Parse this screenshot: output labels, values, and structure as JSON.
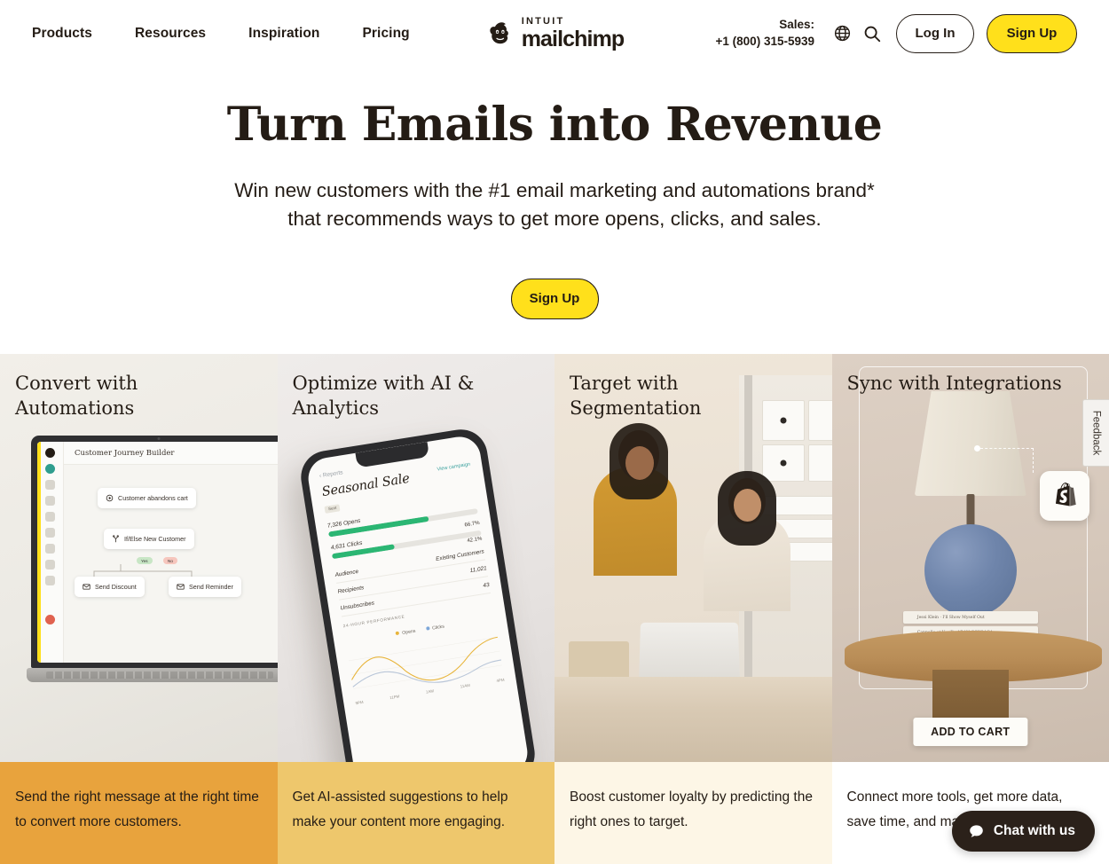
{
  "header": {
    "nav_items": [
      {
        "label": "Products"
      },
      {
        "label": "Resources"
      },
      {
        "label": "Inspiration"
      },
      {
        "label": "Pricing"
      }
    ],
    "logo": {
      "brand_prefix": "INTUIT",
      "brand_name": "mailchimp",
      "icon": "mailchimp-chimp-icon"
    },
    "sales_label": "Sales:",
    "sales_phone": "+1 (800) 315-5939",
    "globe_icon": "globe-icon",
    "search_icon": "search-icon",
    "login_label": "Log In",
    "signup_label": "Sign Up"
  },
  "hero": {
    "title": "Turn Emails into Revenue",
    "subtitle": "Win new customers with the #1 email marketing and automations brand* that recommends ways to get more opens, clicks, and sales.",
    "cta_label": "Sign Up"
  },
  "cards": [
    {
      "title": "Convert with Automations",
      "description": "Send the right message at the right time to convert more customers.",
      "bg_color": "#e8a33d",
      "scene": {
        "app_title": "Customer Journey Builder",
        "nodes": [
          {
            "label": "Customer abandons cart",
            "icon": "play-circle-icon"
          },
          {
            "label": "If/Else New Customer",
            "icon": "branch-icon"
          },
          {
            "label": "Send Discount",
            "icon": "envelope-icon"
          },
          {
            "label": "Send Reminder",
            "icon": "envelope-icon"
          }
        ],
        "branch_yes": "Yes",
        "branch_no": "No"
      }
    },
    {
      "title": "Optimize with AI & Analytics",
      "description": "Get AI-assisted suggestions to help make your content more engaging.",
      "bg_color": "#eec76c",
      "scene": {
        "back_label": "Reports",
        "report_title": "Seasonal Sale",
        "report_tag": "Sent",
        "view_campaign": "View campaign",
        "metrics": [
          {
            "label": "7,326 Opens",
            "pct_label": "66.7%",
            "pct": 66.7
          },
          {
            "label": "4,631 Clicks",
            "pct_label": "42.1%",
            "pct": 42.1
          }
        ],
        "rows": [
          {
            "label": "Audience",
            "value": "Existing Customers"
          },
          {
            "label": "Recipients",
            "value": "11,021"
          },
          {
            "label": "Unsubscribes",
            "value": "43"
          }
        ],
        "section_head": "24-HOUR PERFORMANCE",
        "legend": [
          {
            "label": "Opens",
            "color": "#e8b53c"
          },
          {
            "label": "Clicks",
            "color": "#7da7d9"
          }
        ],
        "x_ticks": [
          "9PM",
          "11PM",
          "1AM",
          "11AM",
          "4PM"
        ]
      }
    },
    {
      "title": "Target with Segmentation",
      "description": "Boost customer loyalty by predicting the right ones to target.",
      "bg_color": "#fdf6e6",
      "scene": {
        "alt": "two women looking at a laptop on a workshop table"
      }
    },
    {
      "title": "Sync with Integrations",
      "description": "Connect more tools, get more data, save time, and make smarter decisions.",
      "bg_color": "#ffffff",
      "scene": {
        "integration_icon": "shopify-icon",
        "cart_label": "ADD TO CART",
        "books": [
          "Jessi Klein  ·  I'll Show Myself Out",
          "Cannelle et Vanille       ARAN GOYOAGA"
        ]
      }
    }
  ],
  "feedback_tab": {
    "label": "Feedback"
  },
  "chat_widget": {
    "label": "Chat with us",
    "icon": "chat-bubble-icon",
    "color": "#2b211a"
  }
}
